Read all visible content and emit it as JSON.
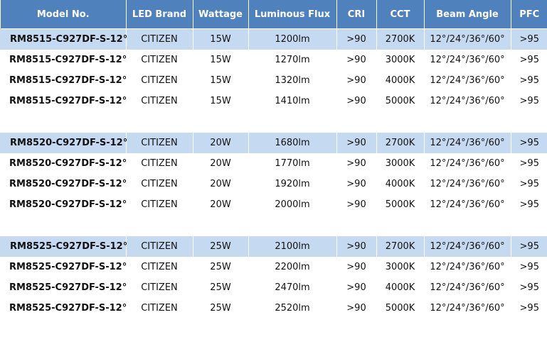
{
  "headers": [
    "Model No.",
    "LED Brand",
    "Wattage",
    "Luminous Flux",
    "CRI",
    "CCT",
    "Beam Angle",
    "PFC"
  ],
  "groups": [
    {
      "rows": [
        [
          "RM8515-C927DF-S-12°",
          "CITIZEN",
          "15W",
          "1200lm",
          ">90",
          "2700K",
          "12°/24°/36°/60°",
          ">95"
        ],
        [
          "RM8515-C927DF-S-12°",
          "CITIZEN",
          "15W",
          "1270lm",
          ">90",
          "3000K",
          "12°/24°/36°/60°",
          ">95"
        ],
        [
          "RM8515-C927DF-S-12°",
          "CITIZEN",
          "15W",
          "1320lm",
          ">90",
          "4000K",
          "12°/24°/36°/60°",
          ">95"
        ],
        [
          "RM8515-C927DF-S-12°",
          "CITIZEN",
          "15W",
          "1410lm",
          ">90",
          "5000K",
          "12°/24°/36°/60°",
          ">95"
        ]
      ]
    },
    {
      "rows": [
        [
          "RM8520-C927DF-S-12°",
          "CITIZEN",
          "20W",
          "1680lm",
          ">90",
          "2700K",
          "12°/24°/36°/60°",
          ">95"
        ],
        [
          "RM8520-C927DF-S-12°",
          "CITIZEN",
          "20W",
          "1770lm",
          ">90",
          "3000K",
          "12°/24°/36°/60°",
          ">95"
        ],
        [
          "RM8520-C927DF-S-12°",
          "CITIZEN",
          "20W",
          "1920lm",
          ">90",
          "4000K",
          "12°/24°/36°/60°",
          ">95"
        ],
        [
          "RM8520-C927DF-S-12°",
          "CITIZEN",
          "20W",
          "2000lm",
          ">90",
          "5000K",
          "12°/24°/36°/60°",
          ">95"
        ]
      ]
    },
    {
      "rows": [
        [
          "RM8525-C927DF-S-12°",
          "CITIZEN",
          "25W",
          "2100lm",
          ">90",
          "2700K",
          "12°/24°/36°/60°",
          ">95"
        ],
        [
          "RM8525-C927DF-S-12°",
          "CITIZEN",
          "25W",
          "2200lm",
          ">90",
          "3000K",
          "12°/24°/36°/60°",
          ">95"
        ],
        [
          "RM8525-C927DF-S-12°",
          "CITIZEN",
          "25W",
          "2470lm",
          ">90",
          "4000K",
          "12°/24°/36°/60°",
          ">95"
        ],
        [
          "RM8525-C927DF-S-12°",
          "CITIZEN",
          "25W",
          "2520lm",
          ">90",
          "5000K",
          "12°/24°/36°/60°",
          ">95"
        ]
      ]
    }
  ],
  "colors": {
    "header_bg": "#4f81bd",
    "header_text": "#ffffff",
    "highlight_row_bg": "#c5d9f1"
  }
}
